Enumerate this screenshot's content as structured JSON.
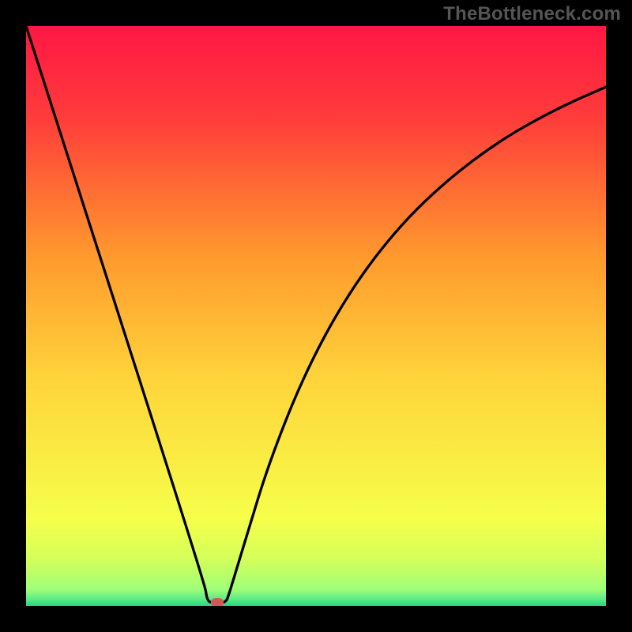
{
  "watermark": "TheBottleneck.com",
  "chart_data": {
    "type": "line",
    "title": "",
    "xlabel": "",
    "ylabel": "",
    "xlim": [
      0,
      100
    ],
    "ylim": [
      0,
      100
    ],
    "series": [
      {
        "name": "curve",
        "points": [
          [
            0,
            100
          ],
          [
            30.8,
            4.0
          ],
          [
            31.2,
            1.0
          ],
          [
            32.0,
            0.5
          ],
          [
            34.4,
            0.5
          ],
          [
            35.0,
            2.0
          ],
          [
            38.0,
            12.0
          ],
          [
            42.0,
            25.0
          ],
          [
            48.0,
            40.0
          ],
          [
            55.0,
            53.0
          ],
          [
            63.0,
            64.0
          ],
          [
            72.0,
            73.0
          ],
          [
            82.0,
            80.5
          ],
          [
            92.0,
            86.0
          ],
          [
            100.0,
            89.5
          ]
        ]
      }
    ],
    "marker": {
      "x_pct": 33.0,
      "y_pct": 0.5,
      "color": "#cf5b54"
    },
    "gradient_stops": [
      {
        "offset": 0.0,
        "color": "#ff1744"
      },
      {
        "offset": 0.155,
        "color": "#ff3b3b"
      },
      {
        "offset": 0.4,
        "color": "#ff9a2d"
      },
      {
        "offset": 0.6,
        "color": "#ffd23a"
      },
      {
        "offset": 0.85,
        "color": "#f6ff4a"
      },
      {
        "offset": 0.92,
        "color": "#d4ff5a"
      },
      {
        "offset": 0.971,
        "color": "#a0ff78"
      },
      {
        "offset": 0.99,
        "color": "#55e887"
      },
      {
        "offset": 1.0,
        "color": "#2bd37e"
      }
    ]
  }
}
